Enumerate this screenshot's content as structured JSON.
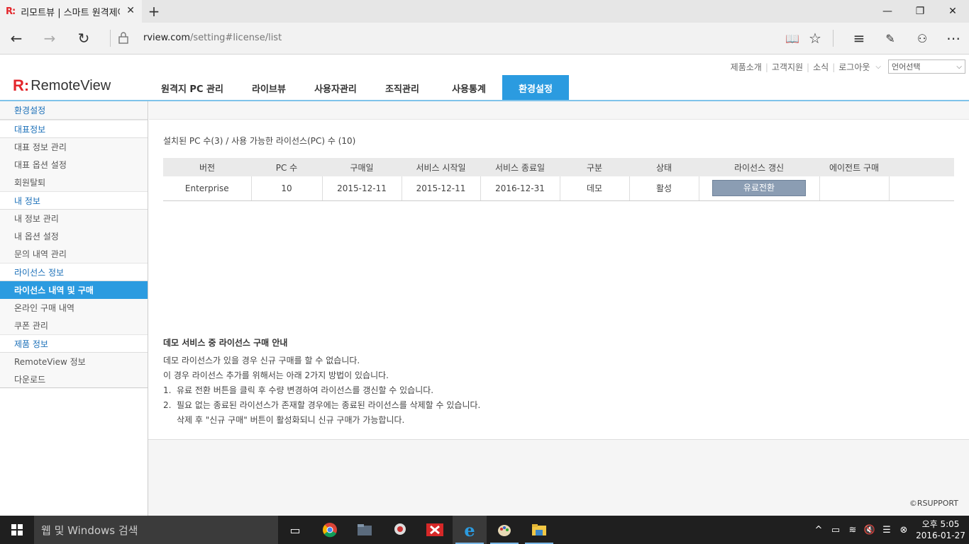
{
  "browser": {
    "tab_title": "리모트뷰 | 스마트 원격제어",
    "tab_favicon": "R:",
    "url_host": "rview.com",
    "url_path": "/setting#license/list"
  },
  "header": {
    "toplinks": [
      "제품소개",
      "고객지원",
      "소식",
      "로그아웃"
    ],
    "language_select": "언어선택",
    "logo_mark": "R:",
    "logo_text": "RemoteView"
  },
  "gnb": [
    {
      "label": "원격지 PC 관리"
    },
    {
      "label": "라이브뷰"
    },
    {
      "label": "사용자관리"
    },
    {
      "label": "조직관리"
    },
    {
      "label": "사용통계"
    },
    {
      "label": "환경설정",
      "active": true
    }
  ],
  "sidebar": {
    "title": "환경설정",
    "groups": [
      {
        "label": "대표정보",
        "items": [
          "대표 정보 관리",
          "대표 옵션 설정",
          "회원탈퇴"
        ]
      },
      {
        "label": "내 정보",
        "items": [
          "내 정보 관리",
          "내 옵션 설정",
          "문의 내역 관리"
        ]
      },
      {
        "label": "라이선스 정보",
        "items": [
          "라이선스 내역 및 구매",
          "온라인 구매 내역",
          "쿠폰 관리"
        ],
        "active_item": 0
      },
      {
        "label": "제품 정보",
        "items": [
          "RemoteView 정보",
          "다운로드"
        ]
      }
    ]
  },
  "main": {
    "summary": "설치된 PC 수(3) / 사용 가능한 라이선스(PC) 수 (10)",
    "table": {
      "headers": [
        "버전",
        "PC 수",
        "구매일",
        "서비스 시작일",
        "서비스 종료일",
        "구분",
        "상태",
        "라이선스 갱신",
        "에이전트 구매",
        ""
      ],
      "rows": [
        {
          "version": "Enterprise",
          "pc_count": "10",
          "purchase_date": "2015-12-11",
          "start_date": "2015-12-11",
          "end_date": "2016-12-31",
          "type": "데모",
          "status": "활성",
          "renew_button": "유료전환",
          "agent": ""
        }
      ]
    },
    "guide": {
      "title": "데모 서비스 중 라이선스 구매 안내",
      "line1": "데모 라이선스가 있을 경우 신규 구매를 할 수 없습니다.",
      "line2": "이 경우 라이선스 추가를 위해서는 아래 2가지 방법이 있습니다.",
      "item1_num": "1.",
      "item1": "유료 전환 버튼을 클릭 후 수량 변경하여 라이선스를 갱신할 수 있습니다.",
      "item2_num": "2.",
      "item2": "필요 없는 종료된 라이선스가 존재할 경우에는 종료된 라이선스를 삭제할 수 있습니다.",
      "item2_sub": "삭제 후 \"신규 구매\" 버튼이 활성화되니 신규 구매가 가능합니다."
    },
    "copyright": "©RSUPPORT"
  },
  "taskbar": {
    "search_placeholder": "웹 및 Windows 검색",
    "time": "오후 5:05",
    "date": "2016-01-27"
  },
  "colors": {
    "accent": "#2b9be0",
    "brand_red": "#e3262b",
    "renew_button": "#8b9db3"
  }
}
